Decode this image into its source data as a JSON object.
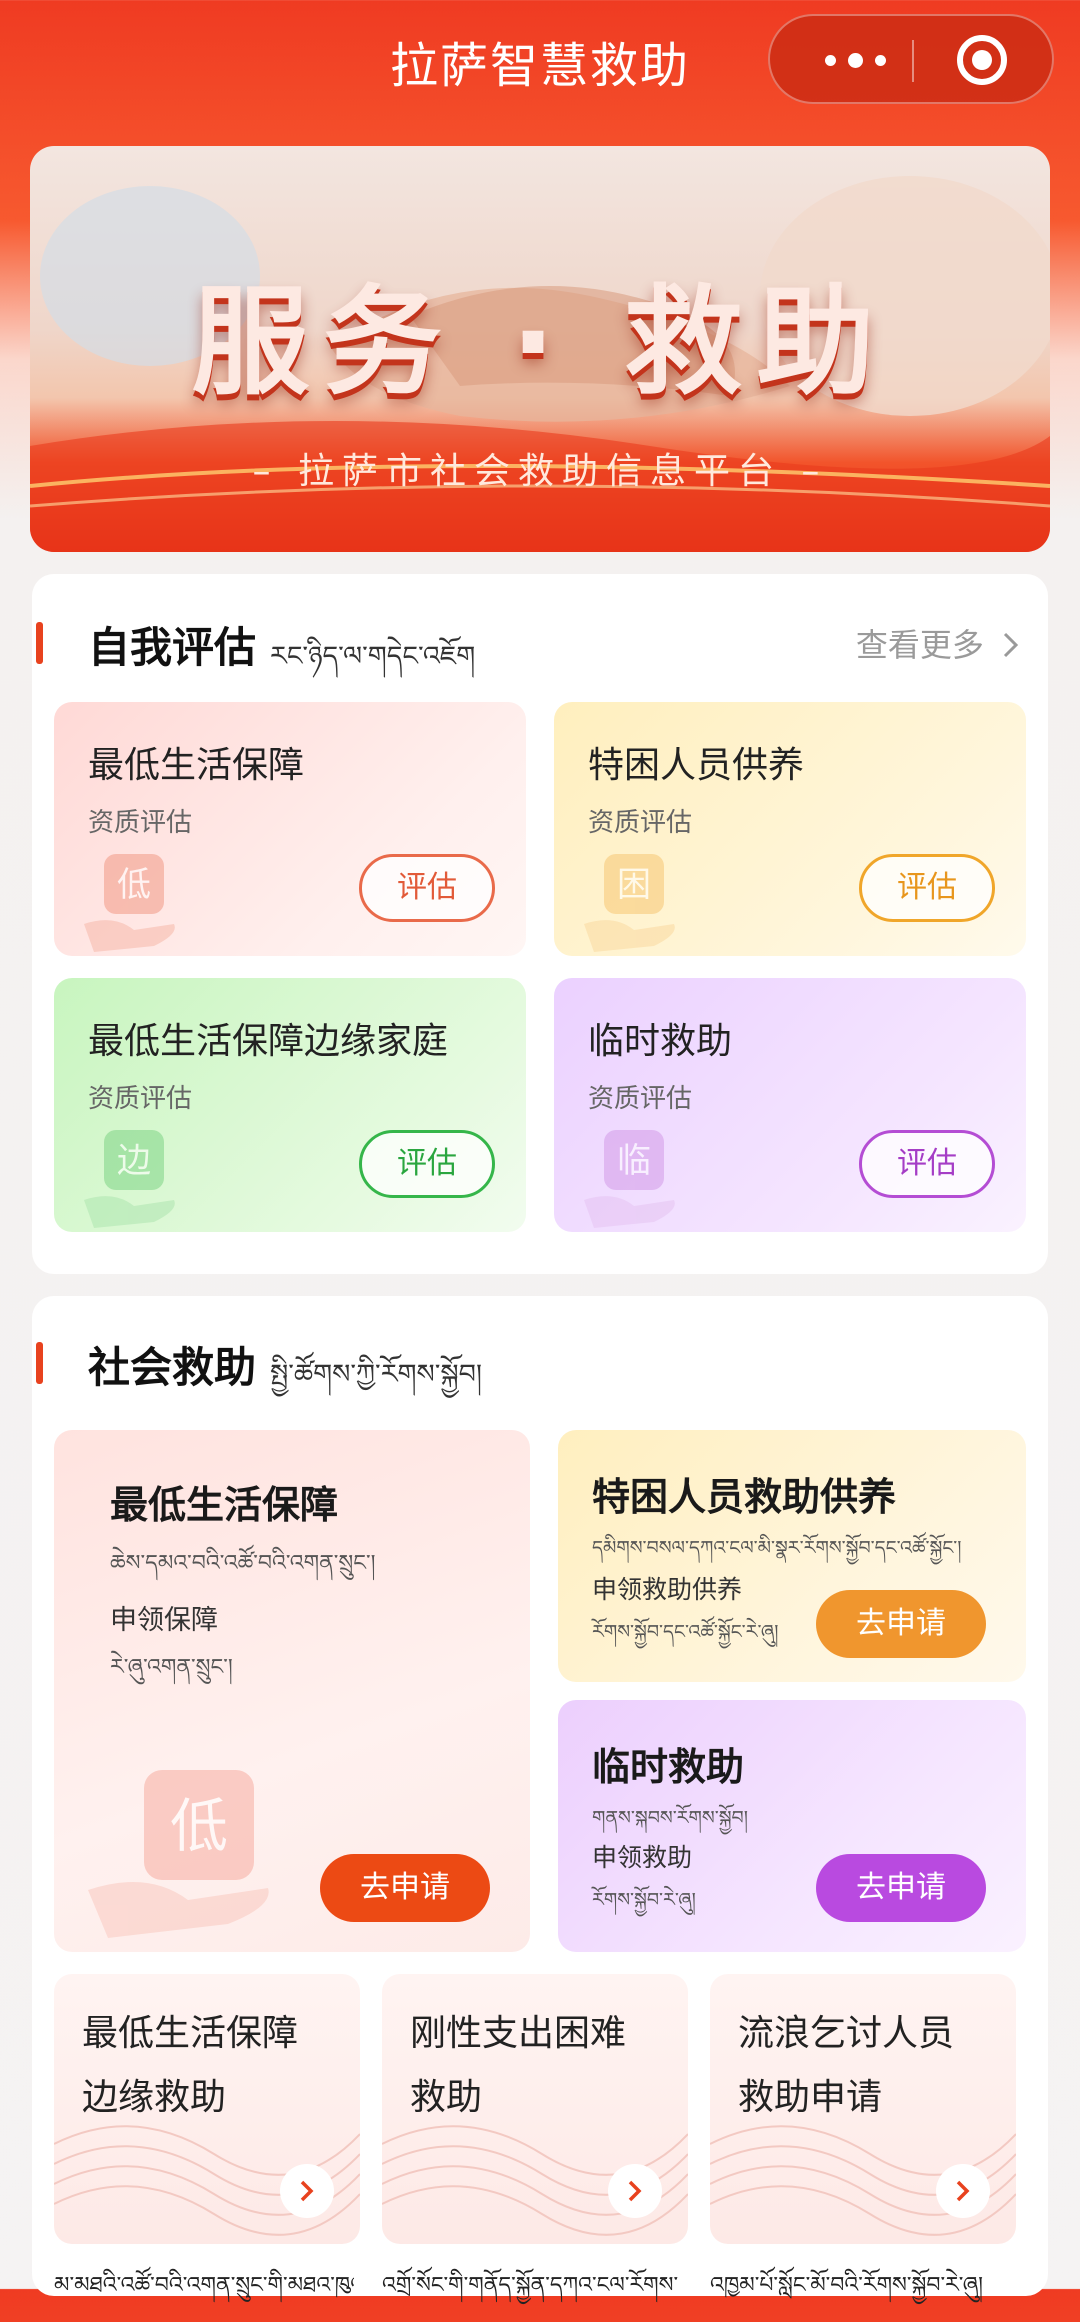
{
  "header": {
    "title": "拉萨智慧救助"
  },
  "banner": {
    "main_text": "服务 · 救助",
    "sub_text": "– 拉萨市社会救助信息平台 –"
  },
  "self_assessment": {
    "title": "自我评估",
    "title_tibetan": "རང་ཉིད་ལ་གདེང་འཇོག",
    "more_label": "查看更多",
    "cards": [
      {
        "title": "最低生活保障",
        "subtitle": "资质评估",
        "button": "评估",
        "icon_char": "低",
        "color": "#e96a4a"
      },
      {
        "title": "特困人员供养",
        "subtitle": "资质评估",
        "button": "评估",
        "icon_char": "困",
        "color": "#f0a62a"
      },
      {
        "title": "最低生活保障边缘家庭",
        "subtitle": "资质评估",
        "button": "评估",
        "icon_char": "边",
        "color": "#35b64a"
      },
      {
        "title": "临时救助",
        "subtitle": "资质评估",
        "button": "评估",
        "icon_char": "临",
        "color": "#b44dd4"
      }
    ]
  },
  "social_aid": {
    "title": "社会救助",
    "title_tibetan": "སྤྱི་ཚོགས་ཀྱི་རོགས་སྐྱོབ།",
    "main_card": {
      "title": "最低生活保障",
      "title_tibetan": "ཆེས་དམའ་བའི་འཚོ་བའི་འགན་སྲུང་།",
      "subtitle": "申领保障",
      "subtitle_tibetan": "རེ་ཞུ་འགན་སྲུང་།",
      "button": "去申请",
      "icon_char": "低"
    },
    "card_tekun": {
      "title": "特困人员救助供养",
      "title_tibetan": "དམིགས་བསལ་དཀའ་ངལ་མི་སྣར་རོགས་སྐྱོབ་དང་འཚོ་སྐྱོང་།",
      "subtitle": "申领救助供养",
      "subtitle_tibetan": "རོགས་སྐྱོབ་དང་འཚོ་སྐྱོང་རེ་ཞུ།",
      "button": "去申请"
    },
    "card_linshi": {
      "title": "临时救助",
      "title_tibetan": "གནས་སྐབས་རོགས་སྐྱོབ།",
      "subtitle": "申领救助",
      "subtitle_tibetan": "རོགས་སྐྱོབ་རེ་ཞུ།",
      "button": "去申请"
    },
    "mini_cards": [
      {
        "line1": "最低生活保障",
        "line2": "边缘救助",
        "tibetan": "མ་མཐའི་འཚོ་བའི་འགན་སྲུང་གི་མཐའ་ཁུལ་"
      },
      {
        "line1": "刚性支出困难",
        "line2": "救助",
        "tibetan": "འགྲོ་སོང་གི་གནོད་སྐྱོན་དཀའ་ངལ་རོགས་"
      },
      {
        "line1": "流浪乞讨人员",
        "line2": "救助申请",
        "tibetan": "འཁྱམ་པོ་སློང་མོ་བའི་རོགས་སྐྱོབ་རེ་ཞུ།"
      }
    ]
  },
  "colors": {
    "brand_red": "#ef3b22",
    "orange_btn": "#f0962e",
    "purple_btn": "#b94ae0",
    "red_btn": "#ec4a14"
  }
}
